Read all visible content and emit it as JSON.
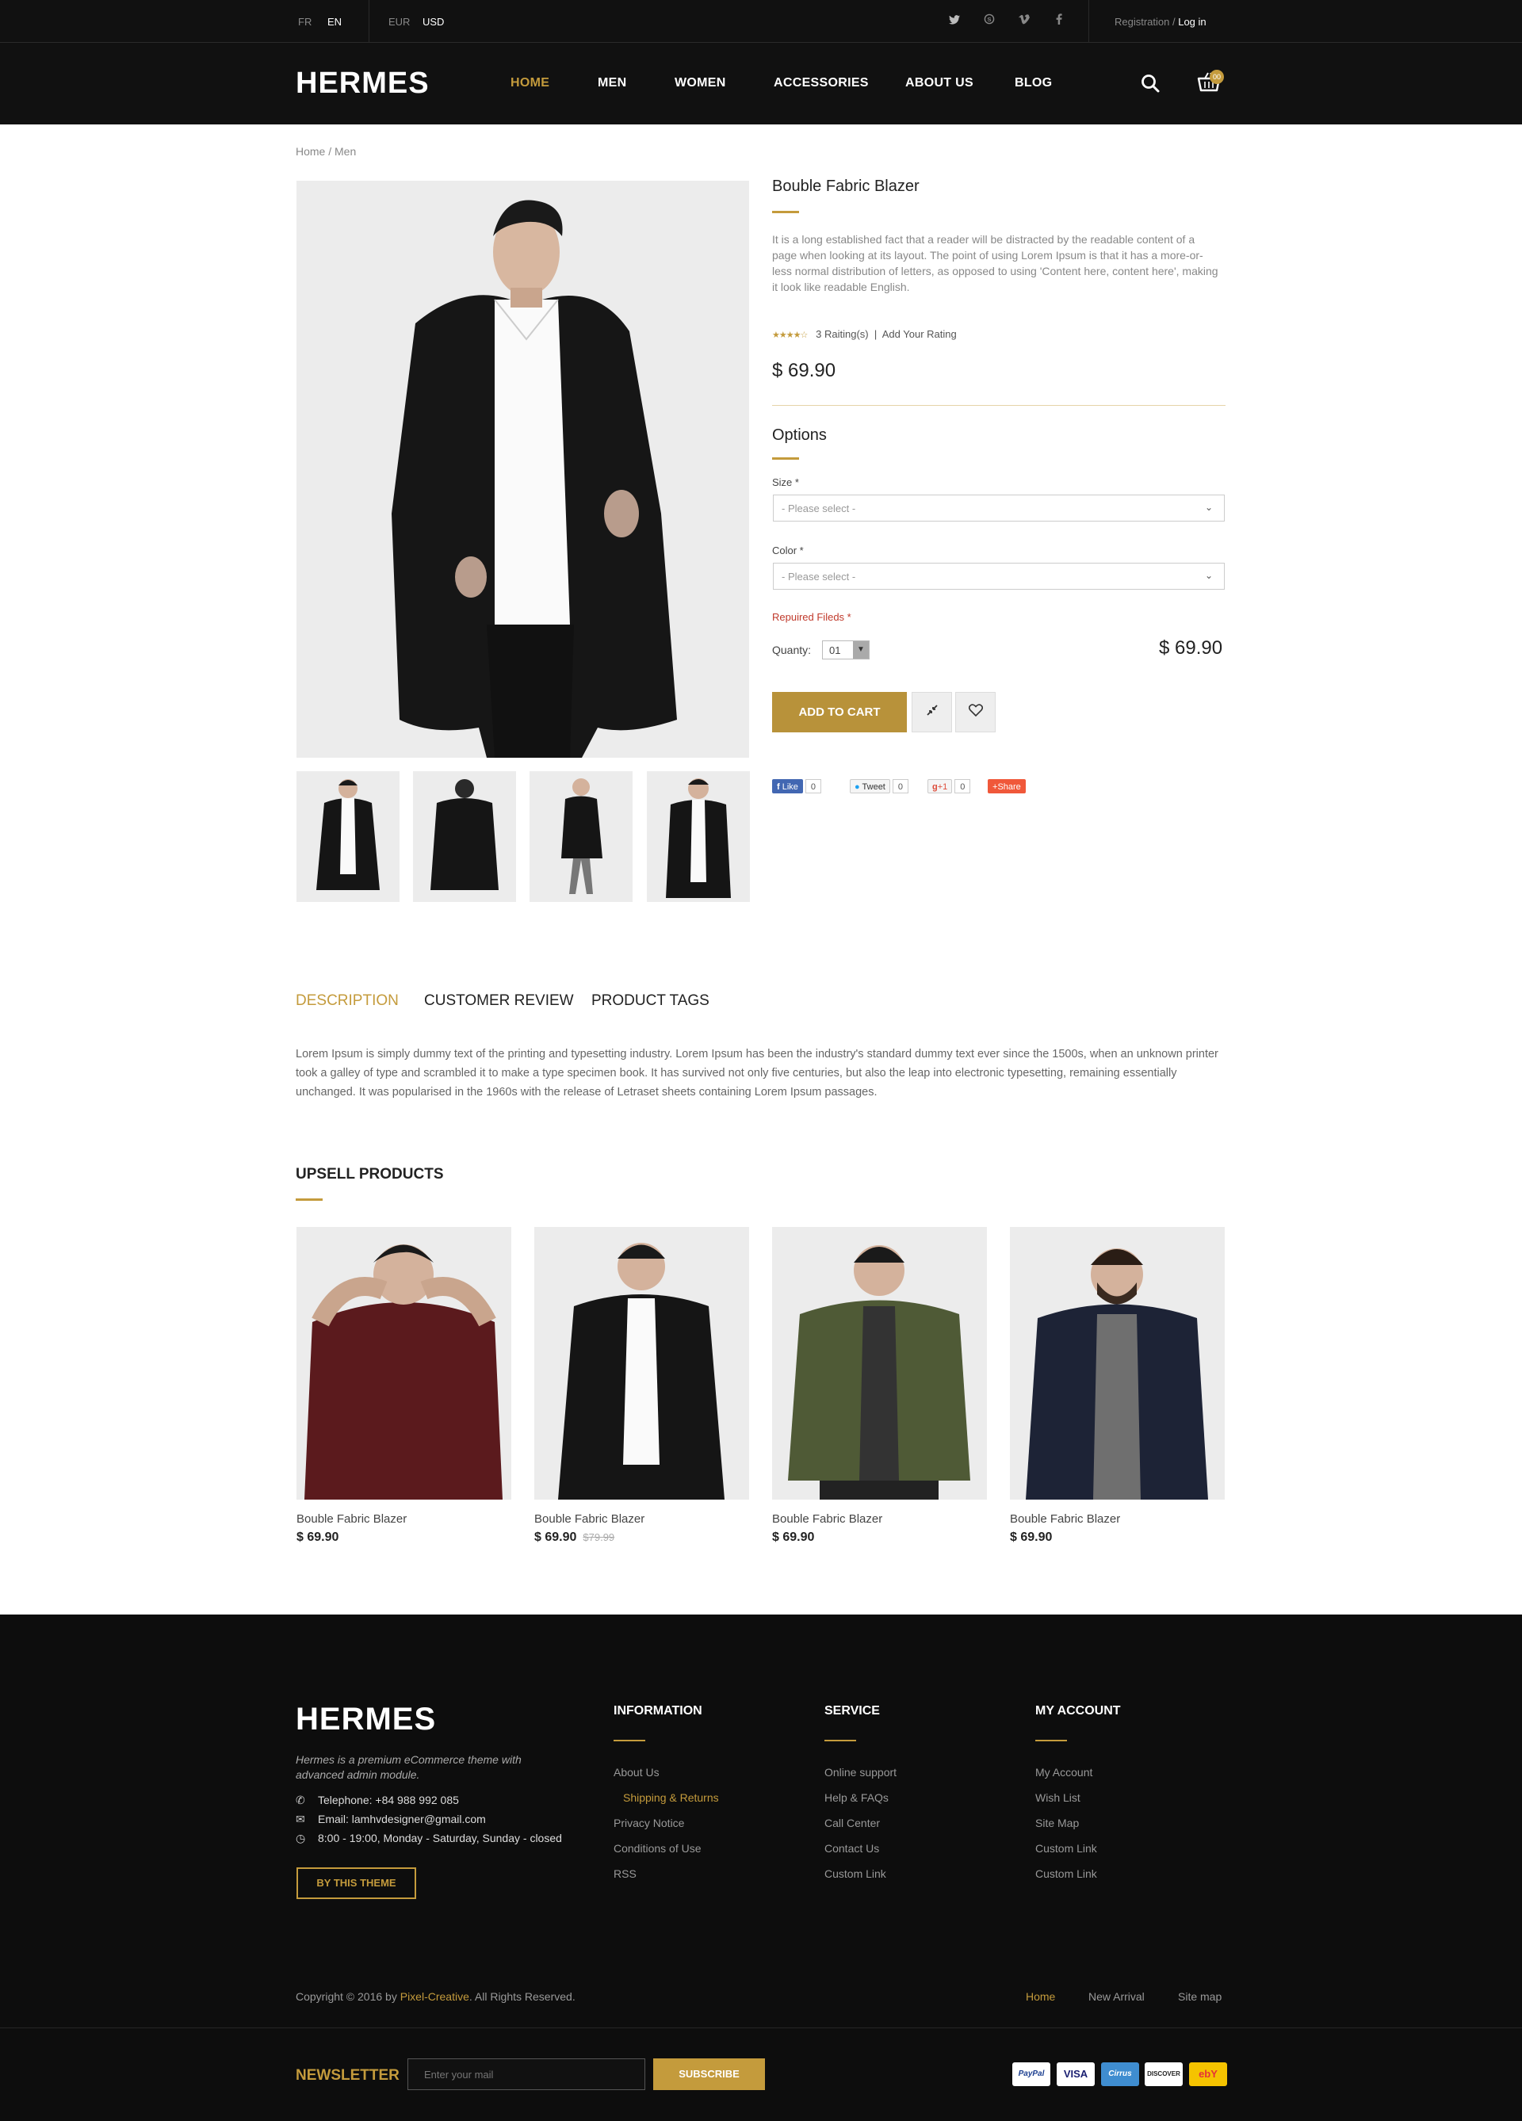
{
  "topbar": {
    "lang": [
      "FR",
      "EN"
    ],
    "currency": [
      "EUR",
      "USD"
    ],
    "social": [
      "twitter-icon",
      "skype-icon",
      "vimeo-icon",
      "facebook-icon"
    ],
    "registration": "Registration",
    "slash": " / ",
    "login": "Log in"
  },
  "header": {
    "logo": "HERMES",
    "nav": [
      "HOME",
      "MEN",
      "WOMEN",
      "ACCESSORIES",
      "ABOUT US",
      "BLOG"
    ],
    "cart_count": "00"
  },
  "breadcrumb": "Home / Men",
  "product": {
    "title": "Bouble Fabric Blazer",
    "description": "It is a long established fact that a reader will be distracted by the readable content of a page when looking at its layout. The point of using Lorem Ipsum is that it has a more-or-less normal distribution of letters, as opposed to using 'Content here, content here', making it look like readable English.",
    "rating_stars": "★★★★☆",
    "rating_count": "3 Raiting(s)",
    "rating_sep": "|",
    "add_rating": "Add Your Rating",
    "price": "$ 69.90",
    "options_title": "Options",
    "size_label": "Size *",
    "size_placeholder": "- Please select -",
    "color_label": "Color *",
    "color_placeholder": "- Please select -",
    "required": "Repuired Fileds *",
    "qty_label": "Quanty:",
    "qty_value": "01",
    "price_right": "$ 69.90",
    "add_to_cart": "ADD TO CART"
  },
  "share": {
    "like": "Like",
    "like_count": "0",
    "tweet": "Tweet",
    "tweet_count": "0",
    "gplus": "+1",
    "gplus_count": "0",
    "share": "Share"
  },
  "tabs": [
    "DESCRIPTION",
    "CUSTOMER REVIEW",
    "PRODUCT TAGS"
  ],
  "tab_body": "Lorem Ipsum is simply dummy text of the printing and typesetting industry. Lorem Ipsum has been the industry's standard dummy text ever since the 1500s, when an unknown printer took a galley of type and scrambled it to make a type specimen book. It has survived not only five centuries, but also the leap into electronic typesetting, remaining essentially unchanged. It was popularised in the 1960s with the release of Letraset sheets containing Lorem Ipsum passages.",
  "upsell": {
    "title": "UPSELL PRODUCTS",
    "items": [
      {
        "name": "Bouble Fabric Blazer",
        "price": "$ 69.90",
        "old_price": ""
      },
      {
        "name": "Bouble Fabric Blazer",
        "price": "$ 69.90",
        "old_price": "$79.99"
      },
      {
        "name": "Bouble Fabric Blazer",
        "price": "$ 69.90",
        "old_price": ""
      },
      {
        "name": "Bouble Fabric Blazer",
        "price": "$ 69.90",
        "old_price": ""
      }
    ]
  },
  "footer": {
    "logo": "HERMES",
    "tagline": "Hermes is a premium eCommerce theme with advanced admin module.",
    "telephone": "Telephone: +84 988 992 085",
    "email": "Email: lamhvdesigner@gmail.com",
    "hours": "8:00 - 19:00, Monday - Saturday, Sunday - closed",
    "theme_button": "BY THIS THEME",
    "information": {
      "title": "INFORMATION",
      "links": [
        "About Us",
        "Shipping & Returns",
        "Privacy Notice",
        "Conditions of Use",
        "RSS"
      ]
    },
    "service": {
      "title": "SERVICE",
      "links": [
        "Online support",
        "Help & FAQs",
        "Call Center",
        "Contact Us",
        "Custom Link"
      ]
    },
    "account": {
      "title": "MY ACCOUNT",
      "links": [
        "My Account",
        "Wish List",
        "Site Map",
        "Custom Link",
        "Custom Link"
      ]
    },
    "copyright_pre": "Copyright © 2016 by ",
    "copyright_brand": "Pixel-Creative",
    "copyright_post": ". All Rights Reserved.",
    "bottom_links": [
      "Home",
      "New Arrival",
      "Site map"
    ],
    "newsletter_title": "NEWSLETTER",
    "newsletter_placeholder": "Enter your mail",
    "subscribe": "SUBSCRIBE",
    "payments": [
      "PayPal",
      "VISA",
      "Cirrus",
      "DISCOVER",
      "ebY"
    ]
  },
  "colors": {
    "accent": "#c49b3c",
    "dark": "#111111"
  }
}
